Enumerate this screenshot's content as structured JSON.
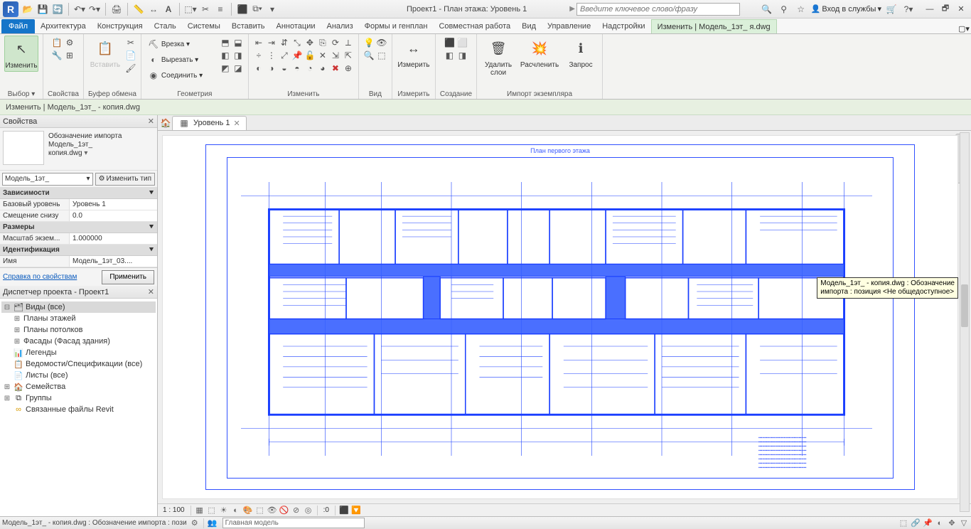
{
  "app_logo": "R",
  "title": "Проект1 - План этажа: Уровень 1",
  "search_placeholder": "Введите ключевое слово/фразу",
  "login_text": "Вход в службы",
  "tabs": {
    "file": "Файл",
    "list": [
      "Архитектура",
      "Конструкция",
      "Сталь",
      "Системы",
      "Вставить",
      "Аннотации",
      "Анализ",
      "Формы и генплан",
      "Совместная работа",
      "Вид",
      "Управление",
      "Надстройки"
    ],
    "active": "Изменить | Модель_1эт_               я.dwg"
  },
  "ribbon": {
    "select": {
      "btn": "Изменить",
      "panel": "Выбор ▾"
    },
    "props": {
      "panel": "Свойства"
    },
    "paste": {
      "btn": "Вставить",
      "panel": "Буфер обмена"
    },
    "clip": {
      "cut": "Врезка ▾",
      "trim": "Вырезать ▾",
      "join": "Соединить ▾"
    },
    "geom_panel": "Геометрия",
    "modify_panel": "Изменить",
    "view_panel": "Вид",
    "measure": {
      "btn": "Измерить",
      "panel": "Измерить"
    },
    "create_panel": "Создание",
    "deletelayers": {
      "btn": "Удалить\nслои"
    },
    "explode": {
      "btn": "Расчленить"
    },
    "partial": {
      "btn": "Запрос"
    },
    "import_panel": "Импорт экземпляра"
  },
  "ctx_text": "Изменить | Модель_1эт_                 - копия.dwg",
  "props": {
    "title": "Свойства",
    "family": "Обозначение импорта\nМодель_1эт_\nкопия.dwg",
    "type_value": "Модель_1эт_",
    "edit_type": "Изменить тип",
    "cat1": "Зависимости",
    "p1n": "Базовый уровень",
    "p1v": "Уровень 1",
    "p2n": "Смещение снизу",
    "p2v": "0.0",
    "cat2": "Размеры",
    "p3n": "Масштаб экзем...",
    "p3v": "1.000000",
    "cat3": "Идентификация",
    "p4n": "Имя",
    "p4v": "Модель_1эт_03....",
    "help": "Справка по свойствам",
    "apply": "Применить"
  },
  "browser": {
    "title": "Диспетчер проекта - Проект1",
    "n_views": "Виды (все)",
    "n_floorplans": "Планы этажей",
    "n_ceilings": "Планы потолков",
    "n_elev": "Фасады (Фасад здания)",
    "n_legends": "Легенды",
    "n_sched": "Ведомости/Спецификации (все)",
    "n_sheets": "Листы (все)",
    "n_fam": "Семейства",
    "n_groups": "Группы",
    "n_links": "Связанные файлы Revit"
  },
  "doc_tab": "Уровень 1",
  "plan_title": "План первого этажа",
  "tooltip": "Модель_1эт_               - копия.dwg : Обозначение\nимпорта : позиция <Не общедоступное>",
  "viewbar": {
    "scale": "1 : 100",
    "zero": ":0"
  },
  "status": {
    "left": "Модель_1эт_             - копия.dwg : Обозначение импорта : пози",
    "model": "Главная модель"
  }
}
